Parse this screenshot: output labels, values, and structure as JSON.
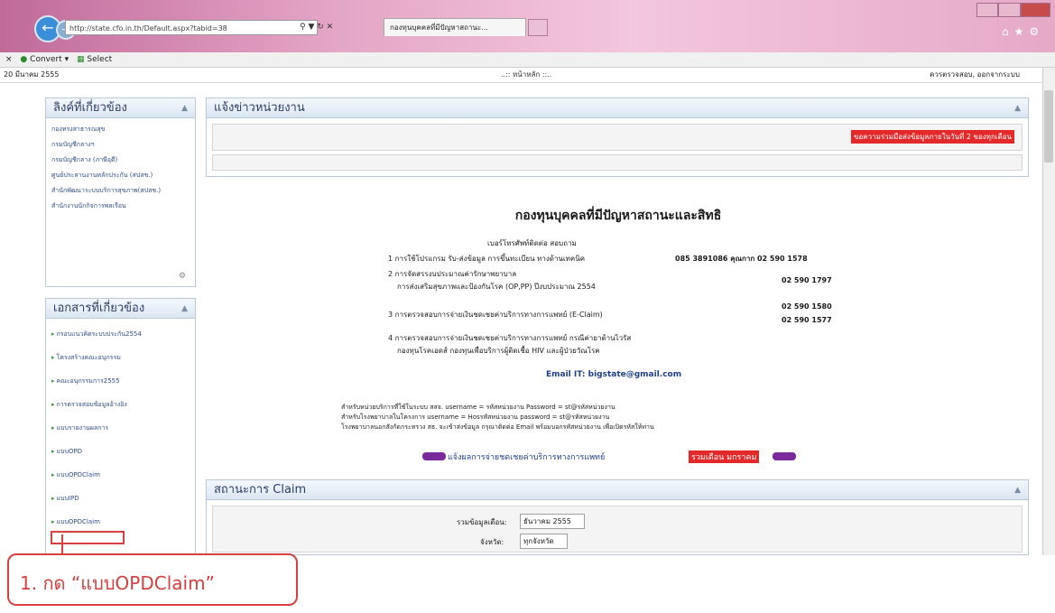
{
  "browser": {
    "address": "http://state.cfo.in.th/Default.aspx?tabid=38",
    "tab_title": "กองทุนบุคคลที่มีปัญหาสถานะ...",
    "convert_label": "Convert",
    "select_label": "Select"
  },
  "page": {
    "date": "20 มีนาคม 2555",
    "home_label": "..:: หน้าหลัก ::..",
    "user_label": "ควรตรวจสอบ, ออกจากระบบ",
    "related_links": {
      "title": "ลิงค์ที่เกี่ยวข้อง",
      "items": [
        "กองทรงสาธารณสุข",
        "กรมบัญชีกลางฯ",
        "กรมบัญชีกลาง (ภาษีอุดี)",
        "ศูนย์ประสานงานหลักประกัน (สปสช.)",
        "สำนักพัฒนาระบบบริการสุขภาพ(สปสช.)",
        "สำนักงานนักกิจการพลเรือน"
      ]
    },
    "documents": {
      "title": "เอกสารที่เกี่ยวข้อง",
      "items": [
        "กรอบแนวคิดระบบประกัน2554",
        "โครงสร้างคณะอนุกรรม",
        "คณะอนุกรรมการ2555",
        "การตรวจสอบข้อมูลอ้างอิง",
        "แบบรายงานผลการ",
        "แบบOPD",
        "แบบOPDClaim",
        "แบบIPD",
        "แบบOPDClaim"
      ]
    },
    "news": {
      "title": "แจ้งข่าวหน่วยงาน",
      "banner": "ขอความร่วมมือส่งข้อมูลภายในวันที่ 2 ของทุกเดือน"
    },
    "main": {
      "heading": "กองทุนบุคคลที่มีปัญหาสถานะและสิทธิ",
      "contact_title": "เบอร์โทรศัพท์ติดต่อ สอบถาม",
      "contacts": [
        {
          "label": "1 การใช้โปรแกรม รับ-ส่งข้อมูล การขึ้นทะเบียน ทางด้านเทคนิค",
          "phone": "085 3891086 คุณกาก 02 590 1578"
        },
        {
          "label": "2 การจัดสรรงบประมาณค่ารักษาพยาบาล",
          "sub": "การส่งเสริมสุขภาพและป้องกันโรค (OP,PP) ปีงบประมาณ 2554",
          "phone": "02 590 1797"
        },
        {
          "label": "3 การตรวจสอบการจ่ายเงินชดเชยค่าบริการทางการแพทย์ (E-Claim)",
          "phone": "02 590 1580",
          "phone2": "02 590 1577"
        },
        {
          "label": "4 การตรวจสอบการจ่ายเงินชดเชยค่าบริการทางการแพทย์ กรณีค่ายาต้านไวรัส",
          "sub": "กองทุนโรคเอดส์ กองทุนเพื่อบริการผู้ติดเชื้อ HIV และผู้ป่วยวัณโรค"
        }
      ],
      "email": "Email IT: bigstate@gmail.com",
      "credentials": [
        "สำหรับหน่วยบริการที่ใช้ในระบบ สสจ. username = รหัสหน่วยงาน Password = st@รหัสหน่วยงาน",
        "สำหรับโรงพยาบาลในโครงการ username = Hosรหัสหน่วยงาน password = st@รหัสหน่วยงาน",
        "โรงพยาบาลนอกสังกัดกระทรวง สธ. จะเข้าส่งข้อมูล กรุณาติดต่อ Email พร้อมบอกรหัสหน่วยงาน เพื่อเปิดรหัสให้ท่าน"
      ],
      "announcement": "แจ้งผลการจ่ายชดเชยค่าบริการทางการแพทย์",
      "announcement_tag": "รวมเดือน มกราคม"
    },
    "claims": {
      "title": "สถานะการ Claim",
      "month_label": "รวมข้อมูลเดือน:",
      "month_value": "ธันวาคม 2555",
      "province_label": "จังหวัด:",
      "province_value": "ทุกจังหวัด"
    }
  },
  "callout": {
    "text": "1. กด “แบบOPDClaim”"
  }
}
